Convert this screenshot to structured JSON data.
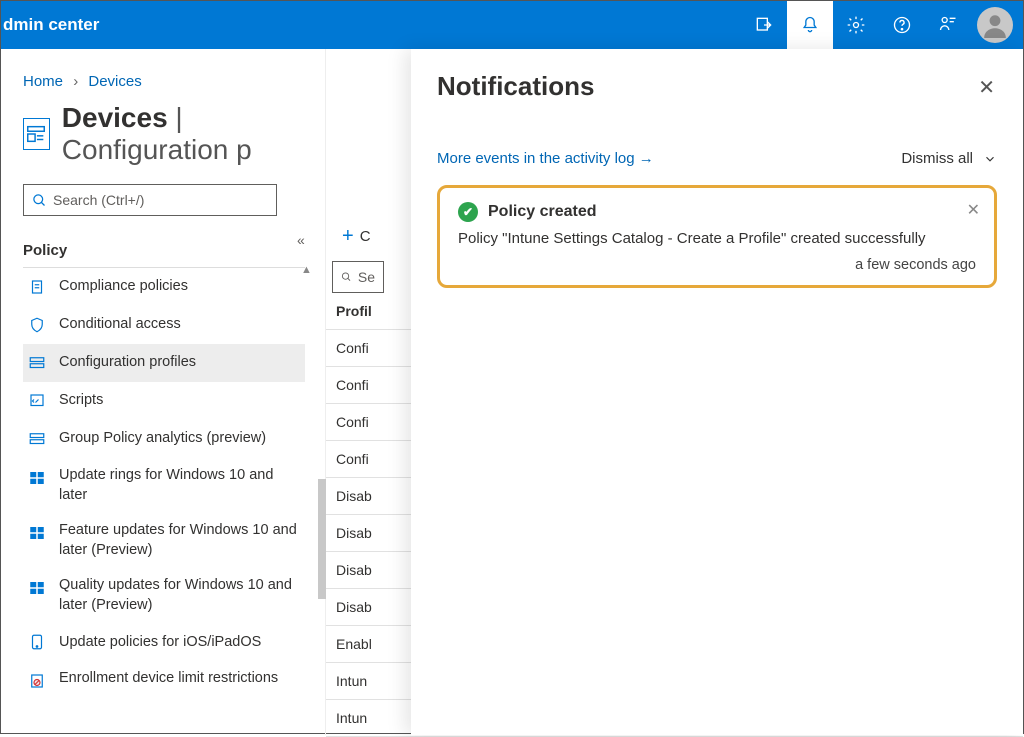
{
  "header": {
    "title": "dmin center"
  },
  "breadcrumb": {
    "home": "Home",
    "devices": "Devices"
  },
  "page": {
    "title_main": "Devices",
    "title_sub": " | Configuration p"
  },
  "search": {
    "placeholder": "Search (Ctrl+/)"
  },
  "section": {
    "label": "Policy"
  },
  "nav": [
    {
      "label": "Compliance policies",
      "icon": "clipboard"
    },
    {
      "label": "Conditional access",
      "icon": "shield"
    },
    {
      "label": "Configuration profiles",
      "icon": "profiles",
      "selected": true
    },
    {
      "label": "Scripts",
      "icon": "script"
    },
    {
      "label": "Group Policy analytics (preview)",
      "icon": "profiles"
    },
    {
      "label": "Update rings for Windows 10 and later",
      "icon": "windows",
      "wrap": true
    },
    {
      "label": "Feature updates for Windows 10 and later (Preview)",
      "icon": "windows",
      "wrap": true
    },
    {
      "label": "Quality updates for Windows 10 and later (Preview)",
      "icon": "windows",
      "wrap": true
    },
    {
      "label": "Update policies for iOS/iPadOS",
      "icon": "ipad"
    },
    {
      "label": "Enrollment device limit restrictions",
      "icon": "restrict",
      "wrap": true
    }
  ],
  "mid": {
    "create": "C",
    "search": "Se",
    "header": "Profil",
    "rows": [
      "Confi",
      "Confi",
      "Confi",
      "Confi",
      "Disab",
      "Disab",
      "Disab",
      "Disab",
      "Enabl",
      "Intun",
      "Intun"
    ]
  },
  "panel": {
    "title": "Notifications",
    "activity_link": "More events in the activity log",
    "dismiss": "Dismiss all",
    "toast": {
      "title": "Policy created",
      "body": "Policy \"Intune Settings Catalog - Create a Profile\" created successfully",
      "time": "a few seconds ago"
    }
  }
}
